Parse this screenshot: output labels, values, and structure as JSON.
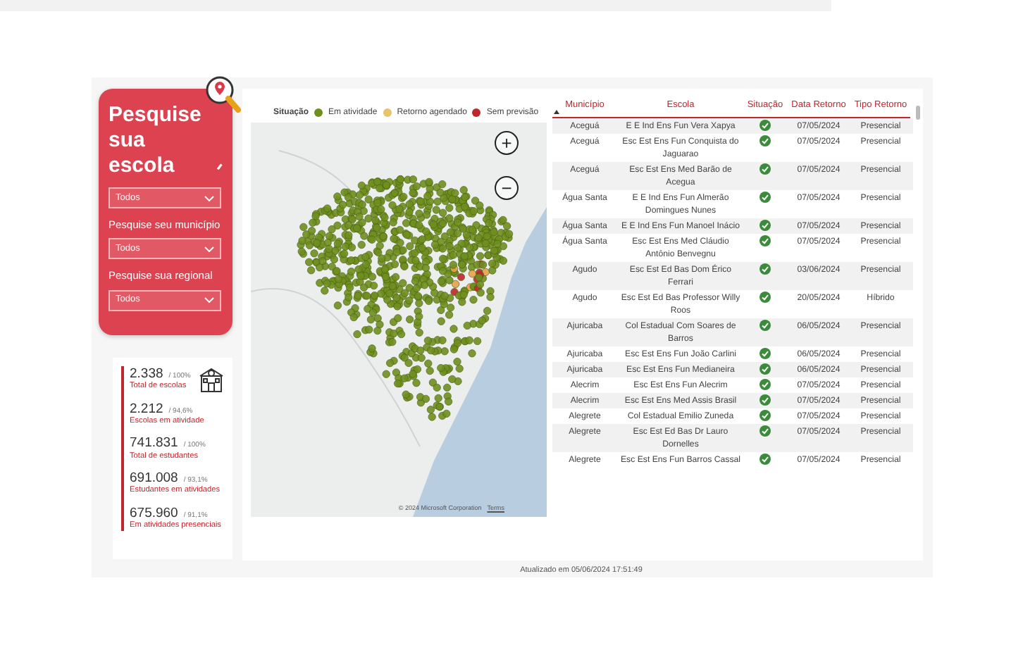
{
  "search_card": {
    "title": "Pesquise sua escola",
    "filters": [
      {
        "value": "Todos"
      },
      {
        "label": "Pesquise seu município",
        "value": "Todos"
      },
      {
        "label": "Pesquise sua regional",
        "value": "Todos"
      }
    ]
  },
  "stats": [
    {
      "value": "2.338",
      "percent": "/ 100%",
      "label": "Total de escolas"
    },
    {
      "value": "2.212",
      "percent": "/ 94,6%",
      "label": "Escolas em atividade"
    },
    {
      "value": "741.831",
      "percent": "/ 100%",
      "label": "Total de estudantes"
    },
    {
      "value": "691.008",
      "percent": "/ 93,1%",
      "label": "Estudantes em atividades"
    },
    {
      "value": "675.960",
      "percent": "/ 91,1%",
      "label": "Em atividades presenciais"
    }
  ],
  "map": {
    "legend_title": "Situação",
    "legend": [
      {
        "label": "Em atividade",
        "color": "#6f8f1f"
      },
      {
        "label": "Retorno agendado",
        "color": "#e8c46a"
      },
      {
        "label": "Sem previsão",
        "color": "#c0272d"
      }
    ],
    "zoom_in": "+",
    "zoom_out": "−",
    "copyright": "© 2024 Microsoft Corporation",
    "terms": "Terms"
  },
  "table": {
    "columns": [
      {
        "label": "Município",
        "sorted": true
      },
      {
        "label": "Escola",
        "sorted": false
      },
      {
        "label": "Situação",
        "sorted": false
      },
      {
        "label": "Data Retorno",
        "sorted": false
      },
      {
        "label": "Tipo Retorno",
        "sorted": false
      }
    ],
    "rows": [
      {
        "municipio": "Aceguá",
        "escola": "E E Ind Ens Fun Vera Xapya",
        "color": "#3c8a3c",
        "data": "07/05/2024",
        "tipo": "Presencial"
      },
      {
        "municipio": "Aceguá",
        "escola": "Esc Est Ens Fun Conquista do Jaguarao",
        "color": "#3c8a3c",
        "data": "07/05/2024",
        "tipo": "Presencial"
      },
      {
        "municipio": "Aceguá",
        "escola": "Esc Est Ens Med Barão de Acegua",
        "color": "#3c8a3c",
        "data": "07/05/2024",
        "tipo": "Presencial"
      },
      {
        "municipio": "Água Santa",
        "escola": "E E Ind Ens Fun Almerão Domingues Nunes",
        "color": "#3c8a3c",
        "data": "07/05/2024",
        "tipo": "Presencial"
      },
      {
        "municipio": "Água Santa",
        "escola": "E E Ind Ens Fun Manoel Inácio",
        "color": "#3c8a3c",
        "data": "07/05/2024",
        "tipo": "Presencial"
      },
      {
        "municipio": "Água Santa",
        "escola": "Esc Est Ens Med Cláudio Antônio Benvegnu",
        "color": "#3c8a3c",
        "data": "07/05/2024",
        "tipo": "Presencial"
      },
      {
        "municipio": "Agudo",
        "escola": "Esc Est Ed Bas Dom Érico Ferrari",
        "color": "#3c8a3c",
        "data": "03/06/2024",
        "tipo": "Presencial"
      },
      {
        "municipio": "Agudo",
        "escola": "Esc Est Ed Bas Professor Willy Roos",
        "color": "#3c8a3c",
        "data": "20/05/2024",
        "tipo": "Híbrido"
      },
      {
        "municipio": "Ajuricaba",
        "escola": "Col Estadual Com Soares de Barros",
        "color": "#3c8a3c",
        "data": "06/05/2024",
        "tipo": "Presencial"
      },
      {
        "municipio": "Ajuricaba",
        "escola": "Esc Est Ens Fun João Carlini",
        "color": "#3c8a3c",
        "data": "06/05/2024",
        "tipo": "Presencial"
      },
      {
        "municipio": "Ajuricaba",
        "escola": "Esc Est Ens Fun Medianeira",
        "color": "#3c8a3c",
        "data": "06/05/2024",
        "tipo": "Presencial"
      },
      {
        "municipio": "Alecrim",
        "escola": "Esc Est Ens Fun Alecrim",
        "color": "#3c8a3c",
        "data": "07/05/2024",
        "tipo": "Presencial"
      },
      {
        "municipio": "Alecrim",
        "escola": "Esc Est Ens Med Assis Brasil",
        "color": "#3c8a3c",
        "data": "07/05/2024",
        "tipo": "Presencial"
      },
      {
        "municipio": "Alegrete",
        "escola": "Col Estadual Emilio Zuneda",
        "color": "#3c8a3c",
        "data": "07/05/2024",
        "tipo": "Presencial"
      },
      {
        "municipio": "Alegrete",
        "escola": "Esc Est Ed Bas Dr Lauro Dornelles",
        "color": "#3c8a3c",
        "data": "07/05/2024",
        "tipo": "Presencial"
      },
      {
        "municipio": "Alegrete",
        "escola": "Esc Est Ens Fun Barros Cassal",
        "color": "#3c8a3c",
        "data": "07/05/2024",
        "tipo": "Presencial"
      }
    ]
  },
  "updated": "Atualizado em 05/06/2024 17:51:49"
}
